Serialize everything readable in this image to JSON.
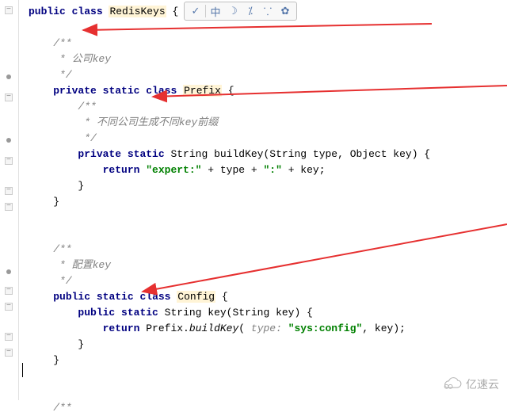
{
  "toolbar": {
    "check_icon": "✓",
    "zhong_icon": "中",
    "moon_icon": "☽",
    "percent_icon": "⁒",
    "people_icon": "⸪",
    "gear_icon": "✿"
  },
  "code": {
    "l1_public": "public",
    "l1_class": "class",
    "l1_name": "RedisKeys",
    "l1_brace": " {",
    "l3_open": "/**",
    "l4": " * 公司key",
    "l5": " */",
    "l6_private": "private",
    "l6_static": "static",
    "l6_class": "class",
    "l6_name": "Prefix",
    "l6_brace": " {",
    "l7_open": "/**",
    "l8": " * 不同公司生成不同key前缀",
    "l9": " */",
    "l10_private": "private",
    "l10_static": "static",
    "l10_rest": " String buildKey(String type, Object key) {",
    "l11_return": "return",
    "l11_str1": "\"expert:\"",
    "l11_plus1": " + type + ",
    "l11_str2": "\":\"",
    "l11_plus2": " + key;",
    "l12": "}",
    "l13": "}",
    "l16_open": "/**",
    "l17": " * 配置key",
    "l18": " */",
    "l19_public": "public",
    "l19_static": "static",
    "l19_class": "class",
    "l19_name": "Config",
    "l19_brace": " {",
    "l20_public": "public",
    "l20_static": "static",
    "l20_rest": " String key(String key) {",
    "l21_return": "return",
    "l21_prefix": " Prefix.",
    "l21_method": "buildKey",
    "l21_lparen": "(",
    "l21_typehint": " type: ",
    "l21_str": "\"sys:config\"",
    "l21_rest": ", key);",
    "l22": "}",
    "l23": "}",
    "l26_open": "/**"
  },
  "watermark": {
    "text": "亿速云"
  }
}
